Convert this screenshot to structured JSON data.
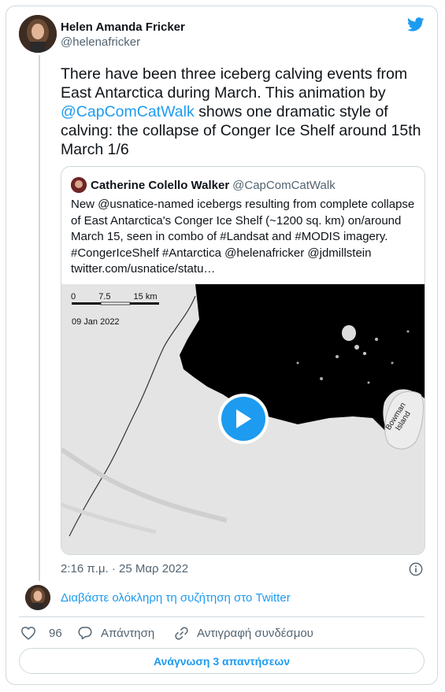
{
  "tweet": {
    "author_name": "Helen Amanda Fricker",
    "author_handle": "@helenafricker",
    "text_before": "There have been three iceberg calving events from East Antarctica during March. This animation by ",
    "mention": "@CapComCatWalk",
    "text_after": " shows one dramatic style of calving: the collapse of Conger Ice Shelf around 15th March 1/6",
    "timestamp": "2:16 π.μ. · 25 Μαρ 2022",
    "read_thread_label": "Διαβάστε ολόκληρη τη συζήτηση στο Twitter",
    "likes": "96",
    "reply_label": "Απάντηση",
    "copy_link_label": "Αντιγραφή συνδέσμου",
    "replies_button_label": "Ανάγνωση 3 απαντήσεων"
  },
  "quoted": {
    "author_name": "Catherine Colello Walker",
    "author_handle": "@CapComCatWalk",
    "lines": [
      "New @usnatice-named icebergs resulting from complete collapse",
      "of East Antarctica's Conger Ice Shelf (~1200 sq. km) on/around",
      "March 15, seen in combo of #Landsat and #MODIS imagery.",
      "#CongerIceShelf #Antarctica @helenafricker @jdmillstein",
      "twitter.com/usnatice/statu…"
    ],
    "media": {
      "scale_labels": [
        "0",
        "7.5",
        "15 km"
      ],
      "date_label": "09 Jan 2022",
      "island_label_1": "Bowman",
      "island_label_2": "Island"
    }
  },
  "icons": [
    "twitter-bird-icon",
    "play-icon",
    "info-icon",
    "heart-icon",
    "reply-icon",
    "link-icon"
  ],
  "colors": {
    "accent": "#1d9bf0",
    "muted": "#536471",
    "border": "#cfd9de"
  }
}
